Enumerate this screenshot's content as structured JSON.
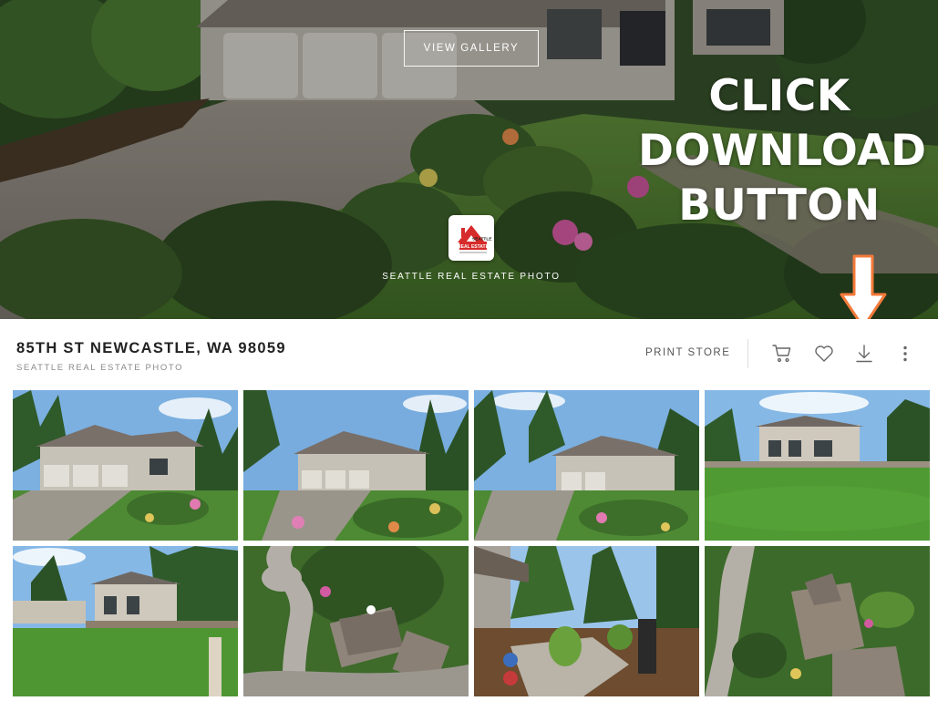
{
  "hero": {
    "view_gallery_label": "VIEW GALLERY",
    "overlay_lines": [
      "CLICK",
      "DOWNLOAD",
      "BUTTON"
    ],
    "logo_caption": "SEATTLE REAL ESTATE PHOTO",
    "logo_text_top": "SEATTLE",
    "logo_text_bottom": "REAL ESTATE"
  },
  "titlebar": {
    "title": "85TH ST NEWCASTLE, WA 98059",
    "subtitle": "SEATTLE REAL ESTATE PHOTO",
    "print_store_label": "PRINT STORE",
    "icons": [
      "cart-icon",
      "heart-icon",
      "download-icon",
      "more-vertical-icon"
    ]
  },
  "thumbnails": [
    {
      "name": "front-exterior-wide"
    },
    {
      "name": "front-exterior-landscaped"
    },
    {
      "name": "front-exterior-driveway"
    },
    {
      "name": "backyard-lawn"
    },
    {
      "name": "backyard-patio"
    },
    {
      "name": "aerial-cul-de-sac"
    },
    {
      "name": "side-yard-path"
    },
    {
      "name": "aerial-top-down"
    }
  ],
  "colors": {
    "annotation_arrow": "#f47a3a",
    "logo_red": "#d72a2a",
    "title_text": "#222222",
    "muted_text": "#8a8a8a"
  }
}
